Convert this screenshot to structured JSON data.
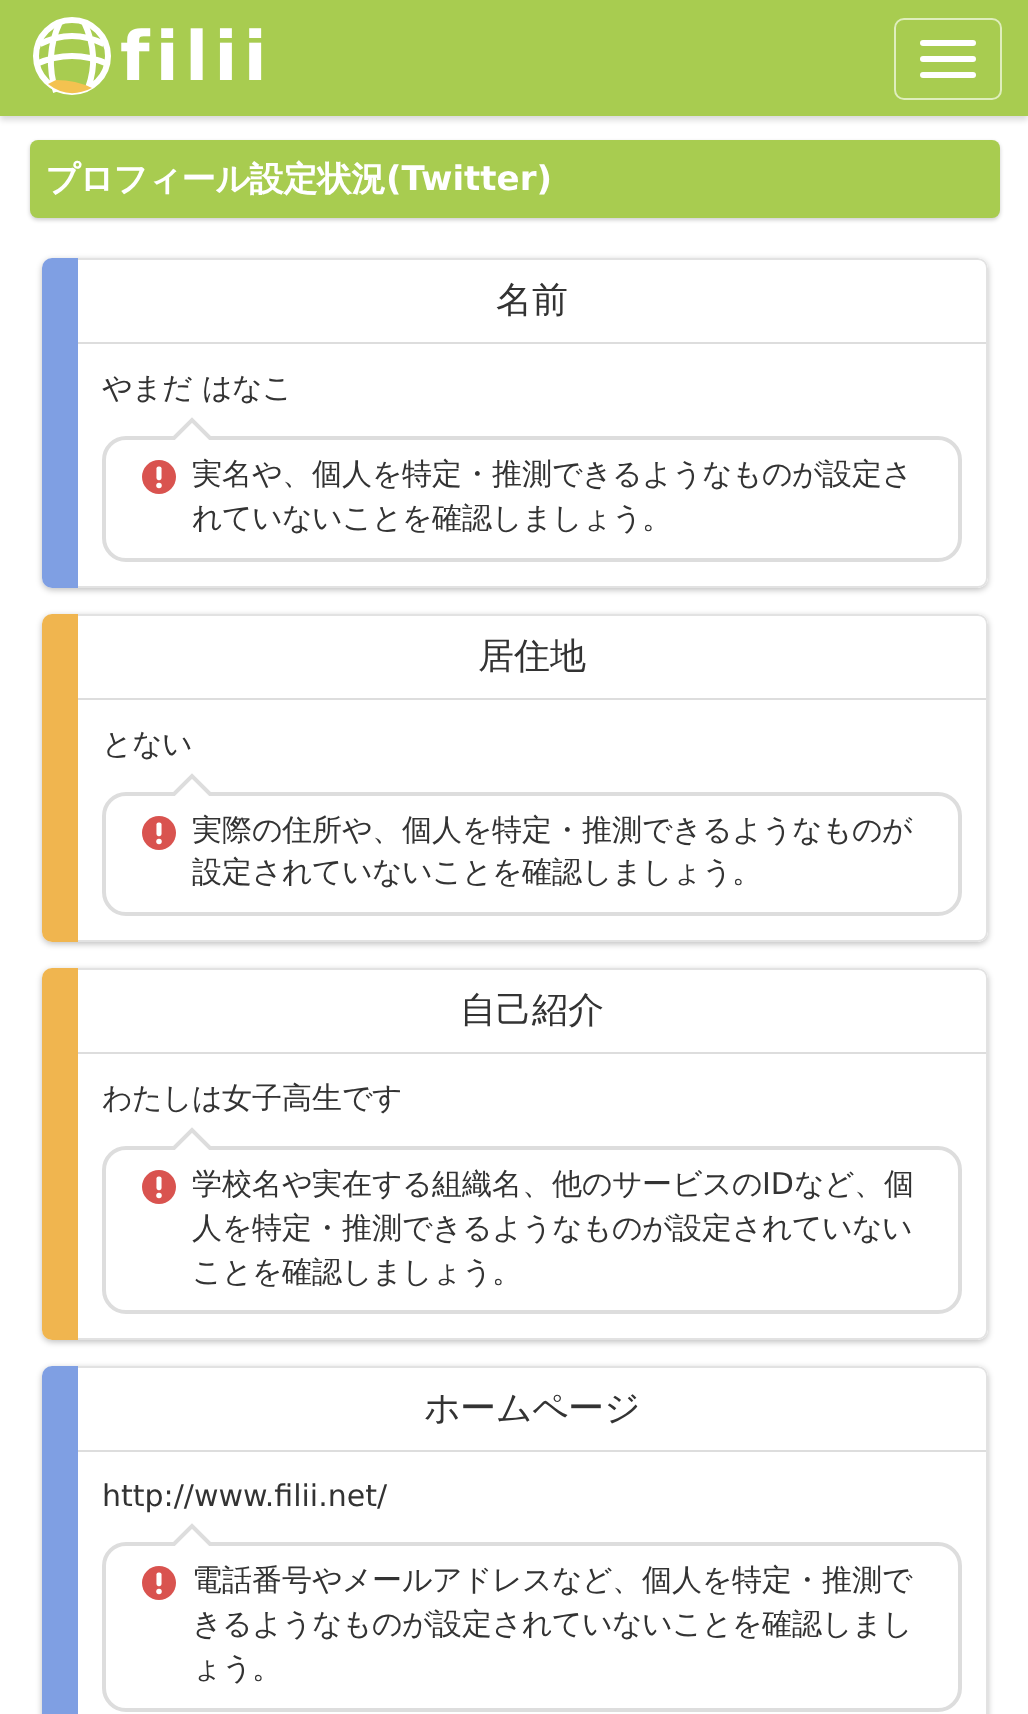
{
  "header": {
    "logo_text": "filii"
  },
  "section_title": "プロフィール設定状況(Twitter)",
  "fields": [
    {
      "label": "名前",
      "value": "やまだ はなこ",
      "color": "#7f9fe3",
      "warning": "実名や、個人を特定・推測できるようなものが設定されていないことを確認しましょう。"
    },
    {
      "label": "居住地",
      "value": "とない",
      "color": "#f0b54f",
      "warning": "実際の住所や、個人を特定・推測できるようなものが設定されていないことを確認しましょう。"
    },
    {
      "label": "自己紹介",
      "value": "わたしは女子高生です",
      "color": "#f0b54f",
      "warning": "学校名や実在する組織名、他のサービスのIDなど、個人を特定・推測できるようなものが設定されていないことを確認しましょう。"
    },
    {
      "label": "ホームページ",
      "value": "http://www.filii.net/",
      "color": "#7f9fe3",
      "warning": "電話番号やメールアドレスなど、個人を特定・推測できるようなものが設定されていないことを確認しましょう。"
    }
  ]
}
